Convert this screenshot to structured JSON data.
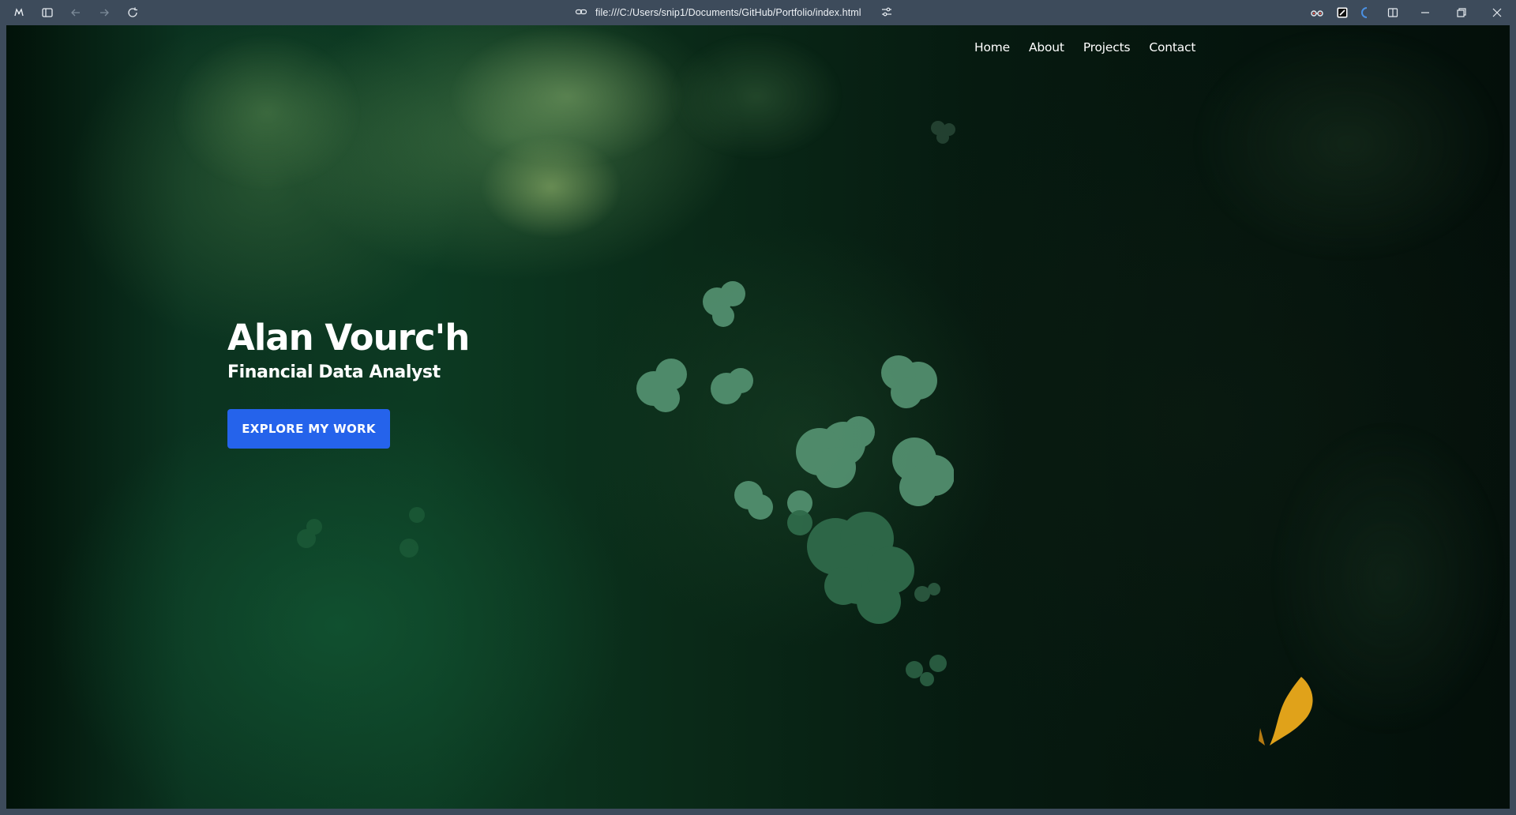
{
  "browser": {
    "url": "file:///C:/Users/snip1/Documents/GitHub/Portfolio/index.html",
    "icons": [
      "app-menu-icon",
      "sidebar-toggle-icon",
      "back-icon",
      "forward-icon",
      "reload-icon",
      "link-icon",
      "site-settings-icon",
      "extension-glasses-icon",
      "extension-black-square-icon",
      "extension-blue-icon",
      "split-view-icon",
      "minimize-icon",
      "restore-icon",
      "close-icon"
    ]
  },
  "page": {
    "nav": [
      {
        "label": "Home"
      },
      {
        "label": "About"
      },
      {
        "label": "Projects"
      },
      {
        "label": "Contact"
      }
    ],
    "hero": {
      "name": "Alan Vourc'h",
      "role": "Financial Data Analyst",
      "cta_label": "EXPLORE MY WORK"
    },
    "colors": {
      "cta": "#2563eb",
      "toolbar": "#3d4b5b"
    }
  }
}
